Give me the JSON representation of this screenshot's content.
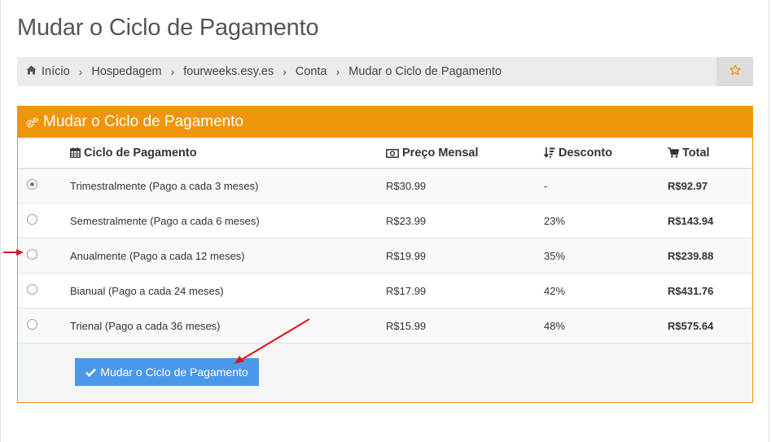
{
  "page": {
    "title": "Mudar o Ciclo de Pagamento"
  },
  "breadcrumb": {
    "items": [
      "Início",
      "Hospedagem",
      "fourweeks.esy.es",
      "Conta",
      "Mudar o Ciclo de Pagamento"
    ],
    "home_icon": "home-icon",
    "separator": "›",
    "favorite_icon": "star-icon"
  },
  "panel": {
    "title": "Mudar o Ciclo de Pagamento",
    "heading_color": "#f0950a",
    "columns": {
      "cycle": "Ciclo de Pagamento",
      "price": "Preço Mensal",
      "discount": "Desconto",
      "total": "Total"
    },
    "rows": [
      {
        "cycle": "Trimestralmente (Pago a cada 3 meses)",
        "price": "R$30.99",
        "discount": "-",
        "total": "R$92.97",
        "selected": true
      },
      {
        "cycle": "Semestralmente (Pago a cada 6 meses)",
        "price": "R$23.99",
        "discount": "23%",
        "total": "R$143.94",
        "selected": false
      },
      {
        "cycle": "Anualmente (Pago a cada 12 meses)",
        "price": "R$19.99",
        "discount": "35%",
        "total": "R$239.88",
        "selected": false
      },
      {
        "cycle": "Bianual (Pago a cada 24 meses)",
        "price": "R$17.99",
        "discount": "42%",
        "total": "R$431.76",
        "selected": false
      },
      {
        "cycle": "Trienal (Pago a cada 36 meses)",
        "price": "R$15.99",
        "discount": "48%",
        "total": "R$575.64",
        "selected": false
      }
    ],
    "submit_label": "Mudar o Ciclo de Pagamento",
    "button_color": "#4a98ea"
  },
  "annotation_color": "#e0141b"
}
